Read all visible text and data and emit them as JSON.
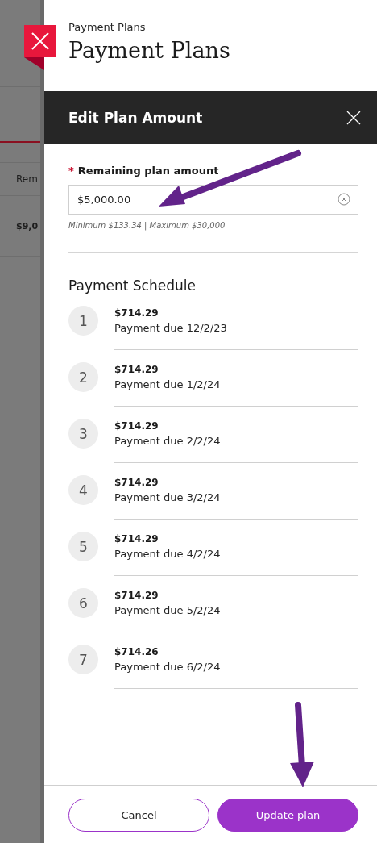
{
  "background": {
    "column_heading": "Rem",
    "cell": "$9,0"
  },
  "header": {
    "breadcrumb": "Payment Plans",
    "title": "Payment Plans"
  },
  "dialog": {
    "title": "Edit Plan Amount",
    "amount_field": {
      "label": "Remaining plan amount",
      "required": true,
      "required_mark": "*",
      "value": "$5,000.00",
      "hint": "Minimum $133.34 | Maximum $30,000"
    },
    "schedule_title": "Payment Schedule",
    "payments": [
      {
        "number": "1",
        "amount": "$714.29",
        "due": "Payment due 12/2/23"
      },
      {
        "number": "2",
        "amount": "$714.29",
        "due": "Payment due 1/2/24"
      },
      {
        "number": "3",
        "amount": "$714.29",
        "due": "Payment due 2/2/24"
      },
      {
        "number": "4",
        "amount": "$714.29",
        "due": "Payment due 3/2/24"
      },
      {
        "number": "5",
        "amount": "$714.29",
        "due": "Payment due 4/2/24"
      },
      {
        "number": "6",
        "amount": "$714.29",
        "due": "Payment due 5/2/24"
      },
      {
        "number": "7",
        "amount": "$714.26",
        "due": "Payment due 6/2/24"
      }
    ],
    "buttons": [
      {
        "label": "Cancel",
        "kind": "secondary"
      },
      {
        "label": "Update plan",
        "kind": "primary"
      }
    ]
  }
}
